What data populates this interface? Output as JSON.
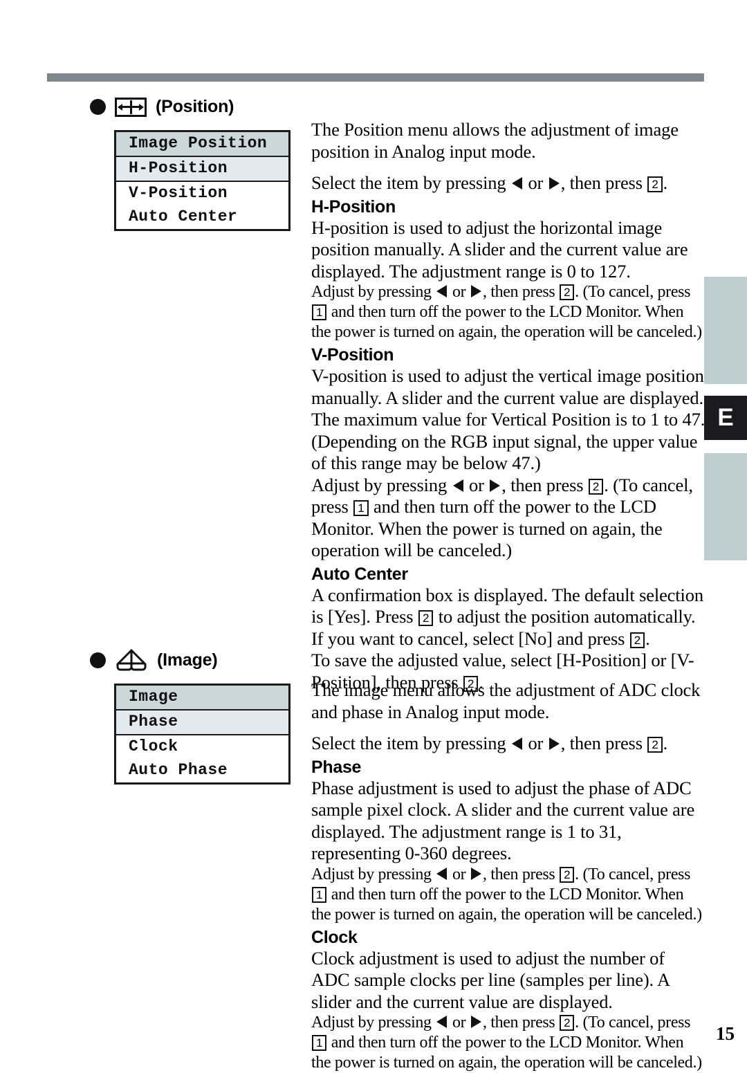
{
  "page": {
    "number": "15",
    "edge_tab_letter": "E"
  },
  "sections": [
    {
      "id": "position",
      "icon_name": "position-icon",
      "label": "(Position)",
      "menu": {
        "title": "Image Position",
        "rows": [
          {
            "label": "H-Position",
            "state": "selected"
          },
          {
            "label": "V-Position",
            "state": "plain"
          },
          {
            "label": "Auto Center",
            "state": "plain"
          }
        ]
      },
      "intro": "The Position menu allows the adjustment of image position in Analog input mode.",
      "select_line_pre": "Select the item by pressing ",
      "select_line_mid": " or ",
      "select_line_post": ", then press ",
      "select_line_end": ".",
      "topics": [
        {
          "heading": "H-Position",
          "body": "H-position is used to adjust the horizontal image position manually.  A slider and the current value are displayed.  The adjustment range is 0 to 127.",
          "note_a": "Adjust by pressing ",
          "note_b": " or ",
          "note_c": ", then press ",
          "note_d": ". (To cancel, press ",
          "note_e": " and then turn off the power to the LCD Monitor. When the power is turned on again, the operation will be canceled.)"
        },
        {
          "heading": "V-Position",
          "body": "V-position is used to adjust the vertical image position manually.  A slider and the current value are displayed. The maximum value for Vertical Position is to 1 to 47. (Depending on the RGB input signal, the upper value of this range may be below 47.)",
          "note_a": "Adjust by pressing ",
          "note_b": " or ",
          "note_c": ", then press ",
          "note_d": ". (To cancel, press ",
          "note_e": " and then turn off the power to the LCD Monitor. When the power is turned on again, the operation will be canceled.)"
        },
        {
          "heading": "Auto Center",
          "line1_a": "A confirmation box is displayed. The default selection is [Yes]. Press ",
          "line1_b": " to adjust the position automatically. If you want to cancel, select [No] and press ",
          "line1_c": ".",
          "line2_a": "To save the adjusted value, select [H-Position] or [V-Position], then press ",
          "line2_b": "."
        }
      ]
    },
    {
      "id": "image",
      "icon_name": "image-icon",
      "label": "(Image)",
      "menu": {
        "title": "Image",
        "rows": [
          {
            "label": "Phase",
            "state": "selected"
          },
          {
            "label": "Clock",
            "state": "plain"
          },
          {
            "label": "Auto Phase",
            "state": "plain"
          }
        ]
      },
      "intro": "The image menu allows the adjustment of ADC clock and phase in Analog input mode.",
      "select_line_pre": "Select the item by pressing ",
      "select_line_mid": " or ",
      "select_line_post": ", then press ",
      "select_line_end": ".",
      "topics": [
        {
          "heading": "Phase",
          "body": "Phase adjustment is used to adjust the phase of ADC sample pixel clock.  A slider and the current value are displayed. The adjustment range is 1 to 31, representing 0-360 degrees.",
          "note_a": "Adjust by pressing ",
          "note_b": " or ",
          "note_c": ", then press ",
          "note_d": ". (To cancel, press ",
          "note_e": " and then turn off the power to the LCD Monitor. When the power is turned on again, the operation will be canceled.)"
        },
        {
          "heading": "Clock",
          "body": "Clock adjustment is used to adjust the number of ADC sample clocks per line (samples per line).  A slider and the current value are displayed.",
          "note_a": "Adjust by pressing ",
          "note_b": " or ",
          "note_c": ", then press ",
          "note_d": ". (To cancel, press ",
          "note_e": " and then turn off the power to the LCD Monitor. When the power is turned on again, the operation will be canceled.)"
        }
      ]
    }
  ],
  "keys": {
    "one": "1",
    "two": "2"
  }
}
